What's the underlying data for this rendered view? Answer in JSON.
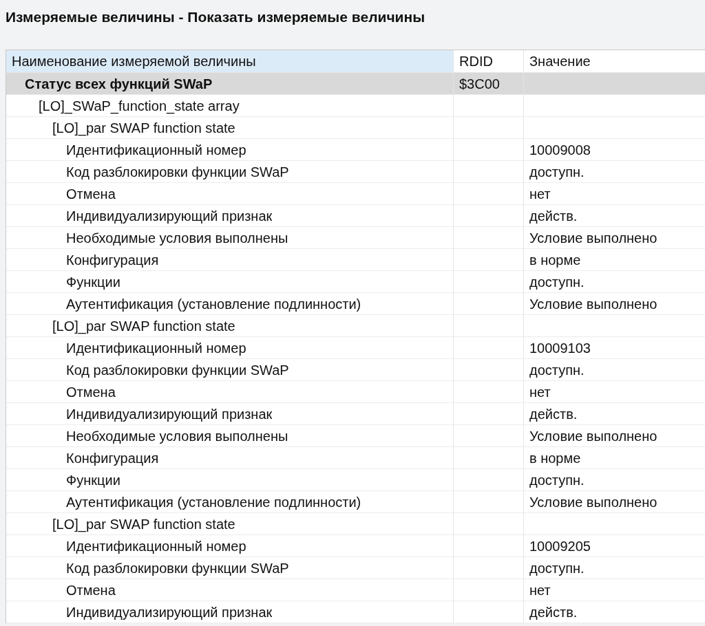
{
  "title": "Измеряемые величины - Показать измеряемые величины",
  "columns": [
    {
      "label": "Наименование измеряемой величины",
      "selected": true
    },
    {
      "label": "RDID",
      "selected": false
    },
    {
      "label": "Значение",
      "selected": false
    }
  ],
  "rows": [
    {
      "name": "Статус всех функций SWaP",
      "rdid": "$3C00",
      "children": [
        {
          "name": "[LO]_SWaP_function_state array",
          "children": [
            {
              "name": "[LO]_par SWAP function state",
              "children": [
                {
                  "name": "Идентификационный номер",
                  "value": "10009008"
                },
                {
                  "name": "Код разблокировки функции SWaP",
                  "value": "доступн."
                },
                {
                  "name": "Отмена",
                  "value": "нет"
                },
                {
                  "name": "Индивидуализирующий признак",
                  "value": "действ."
                },
                {
                  "name": "Необходимые условия выполнены",
                  "value": "Условие выполнено"
                },
                {
                  "name": "Конфигурация",
                  "value": "в норме"
                },
                {
                  "name": "Функции",
                  "value": "доступн."
                },
                {
                  "name": "Аутентификация (установление подлинности)",
                  "value": "Условие выполнено"
                }
              ]
            },
            {
              "name": "[LO]_par SWAP function state",
              "children": [
                {
                  "name": "Идентификационный номер",
                  "value": "10009103"
                },
                {
                  "name": "Код разблокировки функции SWaP",
                  "value": "доступн."
                },
                {
                  "name": "Отмена",
                  "value": "нет"
                },
                {
                  "name": "Индивидуализирующий признак",
                  "value": "действ."
                },
                {
                  "name": "Необходимые условия выполнены",
                  "value": "Условие выполнено"
                },
                {
                  "name": "Конфигурация",
                  "value": "в норме"
                },
                {
                  "name": "Функции",
                  "value": "доступн."
                },
                {
                  "name": "Аутентификация (установление подлинности)",
                  "value": "Условие выполнено"
                }
              ]
            },
            {
              "name": "[LO]_par SWAP function state",
              "children": [
                {
                  "name": "Идентификационный номер",
                  "value": "10009205"
                },
                {
                  "name": "Код разблокировки функции SWaP",
                  "value": "доступн."
                },
                {
                  "name": "Отмена",
                  "value": "нет"
                },
                {
                  "name": "Индивидуализирующий признак",
                  "value": "действ."
                }
              ]
            }
          ]
        }
      ]
    }
  ]
}
